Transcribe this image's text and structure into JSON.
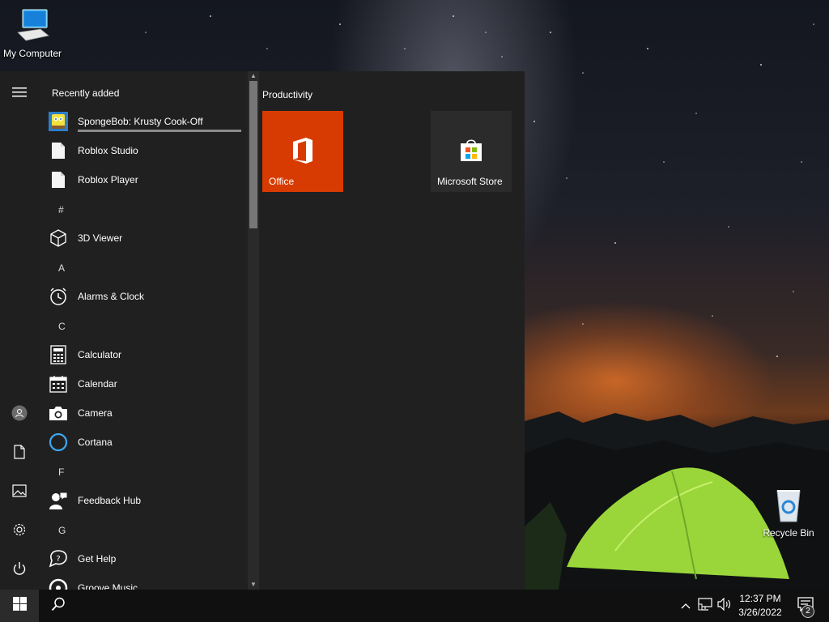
{
  "desktop": {
    "icons": [
      {
        "label": "My Computer",
        "icon": "computer-icon"
      },
      {
        "label": "Recycle Bin",
        "icon": "recycle-bin-icon"
      }
    ]
  },
  "start_menu": {
    "rail": {
      "items": [
        {
          "icon": "hamburger-menu-icon"
        },
        {
          "icon": "user-account-icon"
        },
        {
          "icon": "documents-icon"
        },
        {
          "icon": "pictures-icon"
        },
        {
          "icon": "settings-gear-icon"
        },
        {
          "icon": "power-icon"
        }
      ]
    },
    "app_list": {
      "recently_added_header": "Recently added",
      "install_progress": 1.0,
      "recent": [
        {
          "label": "SpongeBob: Krusty Cook-Off",
          "icon": "spongebob-app-icon"
        },
        {
          "label": "Roblox Studio",
          "icon": "generic-file-icon"
        },
        {
          "label": "Roblox Player",
          "icon": "generic-file-icon"
        }
      ],
      "groups": [
        {
          "letter": "#",
          "apps": [
            {
              "label": "3D Viewer",
              "icon": "cube-3d-icon"
            }
          ]
        },
        {
          "letter": "A",
          "apps": [
            {
              "label": "Alarms & Clock",
              "icon": "alarm-clock-icon"
            }
          ]
        },
        {
          "letter": "C",
          "apps": [
            {
              "label": "Calculator",
              "icon": "calculator-icon"
            },
            {
              "label": "Calendar",
              "icon": "calendar-icon"
            },
            {
              "label": "Camera",
              "icon": "camera-icon"
            },
            {
              "label": "Cortana",
              "icon": "cortana-ring-icon"
            }
          ]
        },
        {
          "letter": "F",
          "apps": [
            {
              "label": "Feedback Hub",
              "icon": "feedback-hub-icon"
            }
          ]
        },
        {
          "letter": "G",
          "apps": [
            {
              "label": "Get Help",
              "icon": "get-help-icon"
            },
            {
              "label": "Groove Music",
              "icon": "groove-music-icon"
            }
          ]
        }
      ]
    },
    "tiles": {
      "group_header": "Productivity",
      "items": [
        {
          "label": "Office",
          "icon": "office-logo-icon",
          "color": "#d83b01"
        },
        {
          "label": "Microsoft Store",
          "icon": "store-bag-icon",
          "color": "#2b2b2b"
        }
      ]
    }
  },
  "taskbar": {
    "start_icon": "windows-logo-icon",
    "search_icon": "search-icon",
    "tray": {
      "icons": [
        "chevron-up-icon",
        "network-icon",
        "volume-icon"
      ],
      "time": "12:37 PM",
      "date": "3/26/2022",
      "notifications_count": "2",
      "notification_icon": "action-center-icon"
    }
  },
  "colors": {
    "menu_bg": "#202020",
    "office_tile": "#d83b01",
    "store_tile": "#2b2b2b",
    "taskbar_bg": "#101010",
    "cortana_blue": "#3ea7f2",
    "tent_green": "#9ad63a"
  }
}
